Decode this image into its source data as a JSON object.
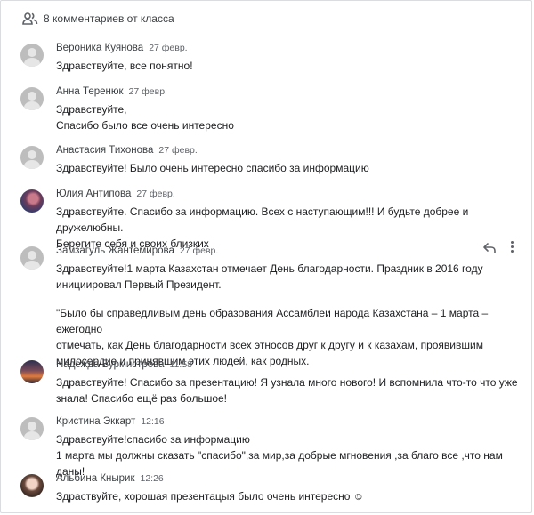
{
  "header": {
    "comment_count_label": "8 комментариев от класса"
  },
  "comments": [
    {
      "author": "Вероника Куянова",
      "date": "27 февр.",
      "paragraphs": [
        "Здравствуйте, все понятно!"
      ]
    },
    {
      "author": "Анна Теренюк",
      "date": "27 февр.",
      "paragraphs": [
        "Здравствуйте,\nСпасибо было все очень интересно"
      ]
    },
    {
      "author": "Анастасия Тихонова",
      "date": "27 февр.",
      "paragraphs": [
        "Здравствуйте! Было очень интересно спасибо за информацию"
      ]
    },
    {
      "author": "Юлия Антипова",
      "date": "27 февр.",
      "paragraphs": [
        "Здравствуйте.  Спасибо за информацию.  Всех с наступающим!!! И будьте добрее и дружелюбны.\nБерегите себя и своих близких"
      ]
    },
    {
      "author": "Замзагуль Жантемирова",
      "date": "27 февр.",
      "paragraphs": [
        "Здравствуйте!1 марта Казахстан отмечает День благодарности. Праздник в 2016 году\nинициировал Первый Президент.",
        "\"Было бы справедливым день образования Ассамблеи народа Казахстана – 1 марта – ежегодно\nотмечать, как День благодарности всех этносов друг к другу и к казахам, проявившим\nмилосердие и принявшим этих людей, как родных."
      ]
    },
    {
      "author": "Надежда Бурмистрова",
      "date": "11:58",
      "paragraphs": [
        "Здравствуйте! Спасибо за презентацию! Я узнала много нового! И вспомнила что-то что уже\nзнала! Спасибо ещё раз большое!"
      ]
    },
    {
      "author": "Кристина Эккарт",
      "date": "12:16",
      "paragraphs": [
        "Здравствуйте!спасибо за информацию\n1 марта мы должны сказать \"спасибо\",за мир,за добрые мгновения ,за благо все ,что нам даны!"
      ]
    },
    {
      "author": "Альбина Кнырик",
      "date": "12:26",
      "paragraphs": [
        "Здраствуйте, хорошая презентацыя было очень интересно ☺"
      ]
    }
  ],
  "icons": {
    "header": "people-icon",
    "reply": "reply-icon",
    "more": "more-vert-icon"
  },
  "colors": {
    "text": "#202124",
    "secondary": "#5f6368",
    "avatar_default": "#bdbdbd",
    "border": "#dadce0"
  }
}
